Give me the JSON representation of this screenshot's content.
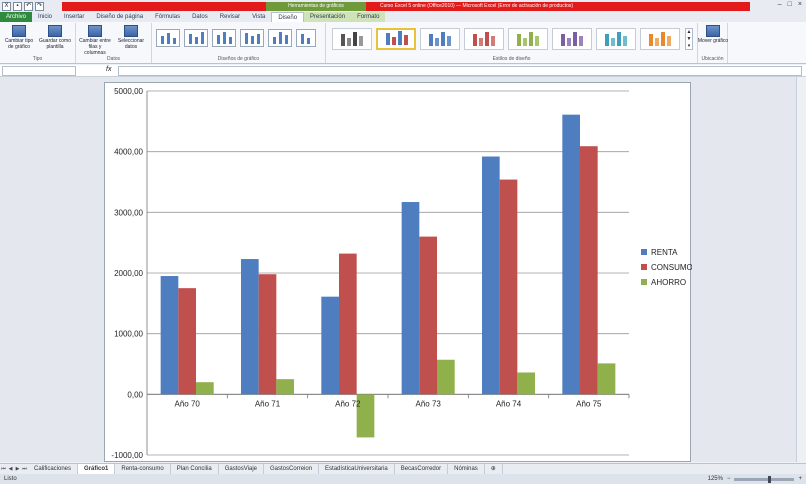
{
  "titlebar": {
    "file_tab": "Archivo",
    "tabs": [
      "Inicio",
      "Insertar",
      "Diseño de página",
      "Fórmulas",
      "Datos",
      "Revisar",
      "Vista",
      "Diseño",
      "Presentación",
      "Formato"
    ],
    "context_title": "Herramientas de gráficos",
    "window_title": "Curso Excel 5 online (Office2010) — Microsoft Excel (Error de activación de productos)",
    "colors": {
      "red_band": "#e21a1a",
      "context_green": "#6e9a3a"
    }
  },
  "ribbon": {
    "groups": [
      {
        "label": "Tipo",
        "buttons": [
          "Cambiar tipo de gráfico",
          "Guardar como plantilla"
        ]
      },
      {
        "label": "Datos",
        "buttons": [
          "Cambiar entre filas y columnas",
          "Seleccionar datos"
        ]
      },
      {
        "label": "Diseños de gráfico"
      },
      {
        "label": "Estilos de diseño"
      },
      {
        "label": "Ubicación",
        "buttons": [
          "Mover gráfico"
        ]
      }
    ]
  },
  "formula_bar": {
    "name_box": "",
    "fx": "fx",
    "value": ""
  },
  "chart_data": {
    "type": "bar",
    "categories": [
      "Año 70",
      "Año 71",
      "Año 72",
      "Año 73",
      "Año 74",
      "Año 75"
    ],
    "series": [
      {
        "name": "RENTA",
        "color": "#4f7ec0",
        "values": [
          1950,
          2230,
          1610,
          3170,
          3920,
          4610
        ]
      },
      {
        "name": "CONSUMO",
        "color": "#c0504d",
        "values": [
          1750,
          1980,
          2320,
          2600,
          3540,
          4090
        ]
      },
      {
        "name": "AHORRO",
        "color": "#8fb04a",
        "values": [
          200,
          250,
          -710,
          570,
          360,
          510
        ]
      }
    ],
    "ylim": [
      -1000,
      5000
    ],
    "yticks": [
      "-1000,00",
      "0,00",
      "1000,00",
      "2000,00",
      "3000,00",
      "4000,00",
      "5000,00"
    ],
    "grid": true,
    "legend": "right"
  },
  "sheets": {
    "tabs": [
      "Calificaciones",
      "Gráfico1",
      "Renta-consumo",
      "Plan Concilia",
      "GastosViaje",
      "GastosCorreion",
      "EstadísticaUniversitaria",
      "BecasCorredor",
      "Nóminas"
    ],
    "active": "Gráfico1"
  },
  "status": {
    "text": "Listo",
    "zoom": "125%"
  }
}
